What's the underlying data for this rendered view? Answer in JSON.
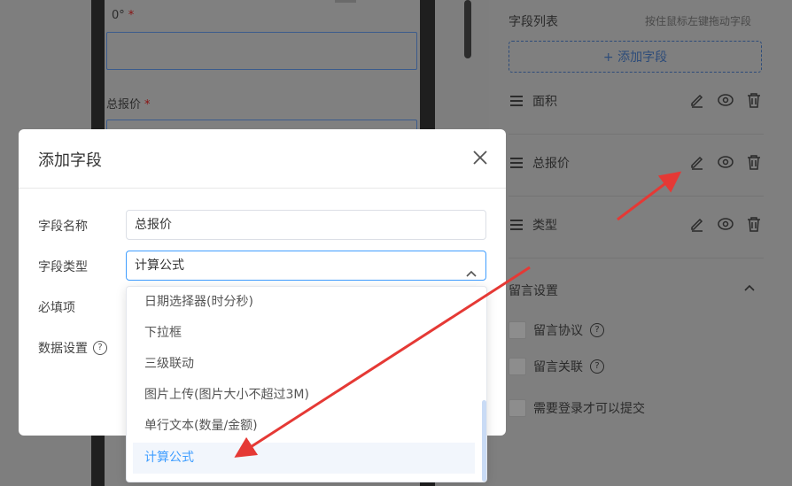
{
  "background": {
    "form": {
      "field_1_label": "0°",
      "field_2_label": "总报价",
      "required_mark": "*"
    },
    "panel": {
      "title": "字段列表",
      "hint": "按住鼠标左键拖动字段",
      "add_field": "+ 添加字段",
      "fields": [
        {
          "label": "面积"
        },
        {
          "label": "总报价"
        },
        {
          "label": "类型"
        }
      ],
      "settings": {
        "title": "留言设置",
        "options": [
          {
            "label": "留言协议",
            "help": true
          },
          {
            "label": "留言关联",
            "help": true
          },
          {
            "label": "需要登录才可以提交",
            "help": false
          }
        ]
      }
    }
  },
  "modal": {
    "title": "添加字段",
    "field_name_label": "字段名称",
    "field_name_value": "总报价",
    "field_type_label": "字段类型",
    "field_type_value": "计算公式",
    "required_label": "必填项",
    "data_settings_label": "数据设置",
    "dropdown_options": [
      "日期选择器(时分秒)",
      "下拉框",
      "三级联动",
      "图片上传(图片大小不超过3M)",
      "单行文本(数量/金额)",
      "计算公式"
    ],
    "selected_option": "计算公式"
  },
  "colors": {
    "accent": "#409eff",
    "annotation_arrow": "#e53935",
    "mask": "#808080"
  }
}
